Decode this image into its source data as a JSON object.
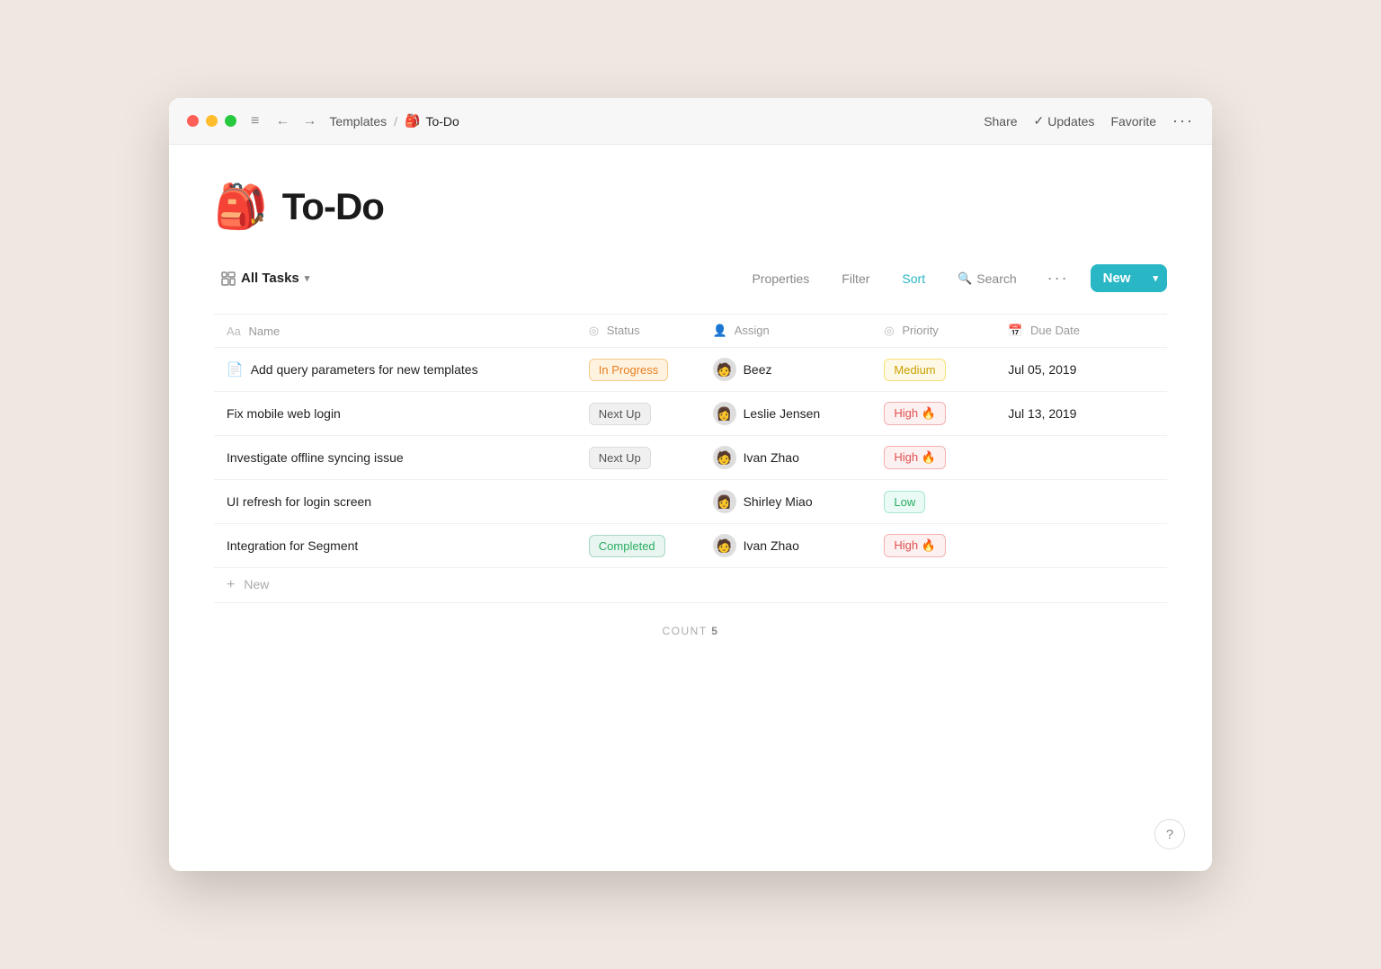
{
  "window": {
    "titlebar": {
      "breadcrumb_parent": "Templates",
      "breadcrumb_separator": "/",
      "breadcrumb_current": "To-Do",
      "breadcrumb_emoji": "🎒",
      "action_share": "Share",
      "action_updates_check": "✓",
      "action_updates": "Updates",
      "action_favorite": "Favorite",
      "action_more": "···"
    }
  },
  "page": {
    "emoji": "🎒",
    "title": "To-Do"
  },
  "toolbar": {
    "view_label": "All Tasks",
    "properties_btn": "Properties",
    "filter_btn": "Filter",
    "sort_btn": "Sort",
    "search_btn": "Search",
    "new_btn": "New",
    "new_btn_arrow": "▾"
  },
  "table": {
    "columns": [
      {
        "key": "name",
        "label": "Name",
        "icon": "Aa"
      },
      {
        "key": "status",
        "label": "Status",
        "icon": "◎"
      },
      {
        "key": "assign",
        "label": "Assign",
        "icon": "👤"
      },
      {
        "key": "priority",
        "label": "Priority",
        "icon": "◎"
      },
      {
        "key": "duedate",
        "label": "Due Date",
        "icon": "📅"
      }
    ],
    "rows": [
      {
        "id": 1,
        "name": "Add query parameters for new templates",
        "has_doc_icon": true,
        "status": "In Progress",
        "status_type": "inprogress",
        "assign": "Beez",
        "assign_emoji": "🧑",
        "priority": "Medium",
        "priority_type": "medium",
        "priority_emoji": "",
        "due_date": "Jul 05, 2019"
      },
      {
        "id": 2,
        "name": "Fix mobile web login",
        "has_doc_icon": false,
        "status": "Next Up",
        "status_type": "nextup",
        "assign": "Leslie Jensen",
        "assign_emoji": "👩",
        "priority": "High 🔥",
        "priority_type": "high",
        "priority_emoji": "🔥",
        "due_date": "Jul 13, 2019"
      },
      {
        "id": 3,
        "name": "Investigate offline syncing issue",
        "has_doc_icon": false,
        "status": "Next Up",
        "status_type": "nextup",
        "assign": "Ivan Zhao",
        "assign_emoji": "🧑",
        "priority": "High 🔥",
        "priority_type": "high",
        "priority_emoji": "🔥",
        "due_date": ""
      },
      {
        "id": 4,
        "name": "UI refresh for login screen",
        "has_doc_icon": false,
        "status": "",
        "status_type": "",
        "assign": "Shirley Miao",
        "assign_emoji": "👩",
        "priority": "Low",
        "priority_type": "low",
        "priority_emoji": "",
        "due_date": ""
      },
      {
        "id": 5,
        "name": "Integration for Segment",
        "has_doc_icon": false,
        "status": "Completed",
        "status_type": "completed",
        "assign": "Ivan Zhao",
        "assign_emoji": "🧑",
        "priority": "High 🔥",
        "priority_type": "high",
        "priority_emoji": "🔥",
        "due_date": ""
      }
    ],
    "add_new_label": "New",
    "count_label": "COUNT",
    "count_value": "5"
  },
  "help": {
    "label": "?"
  }
}
